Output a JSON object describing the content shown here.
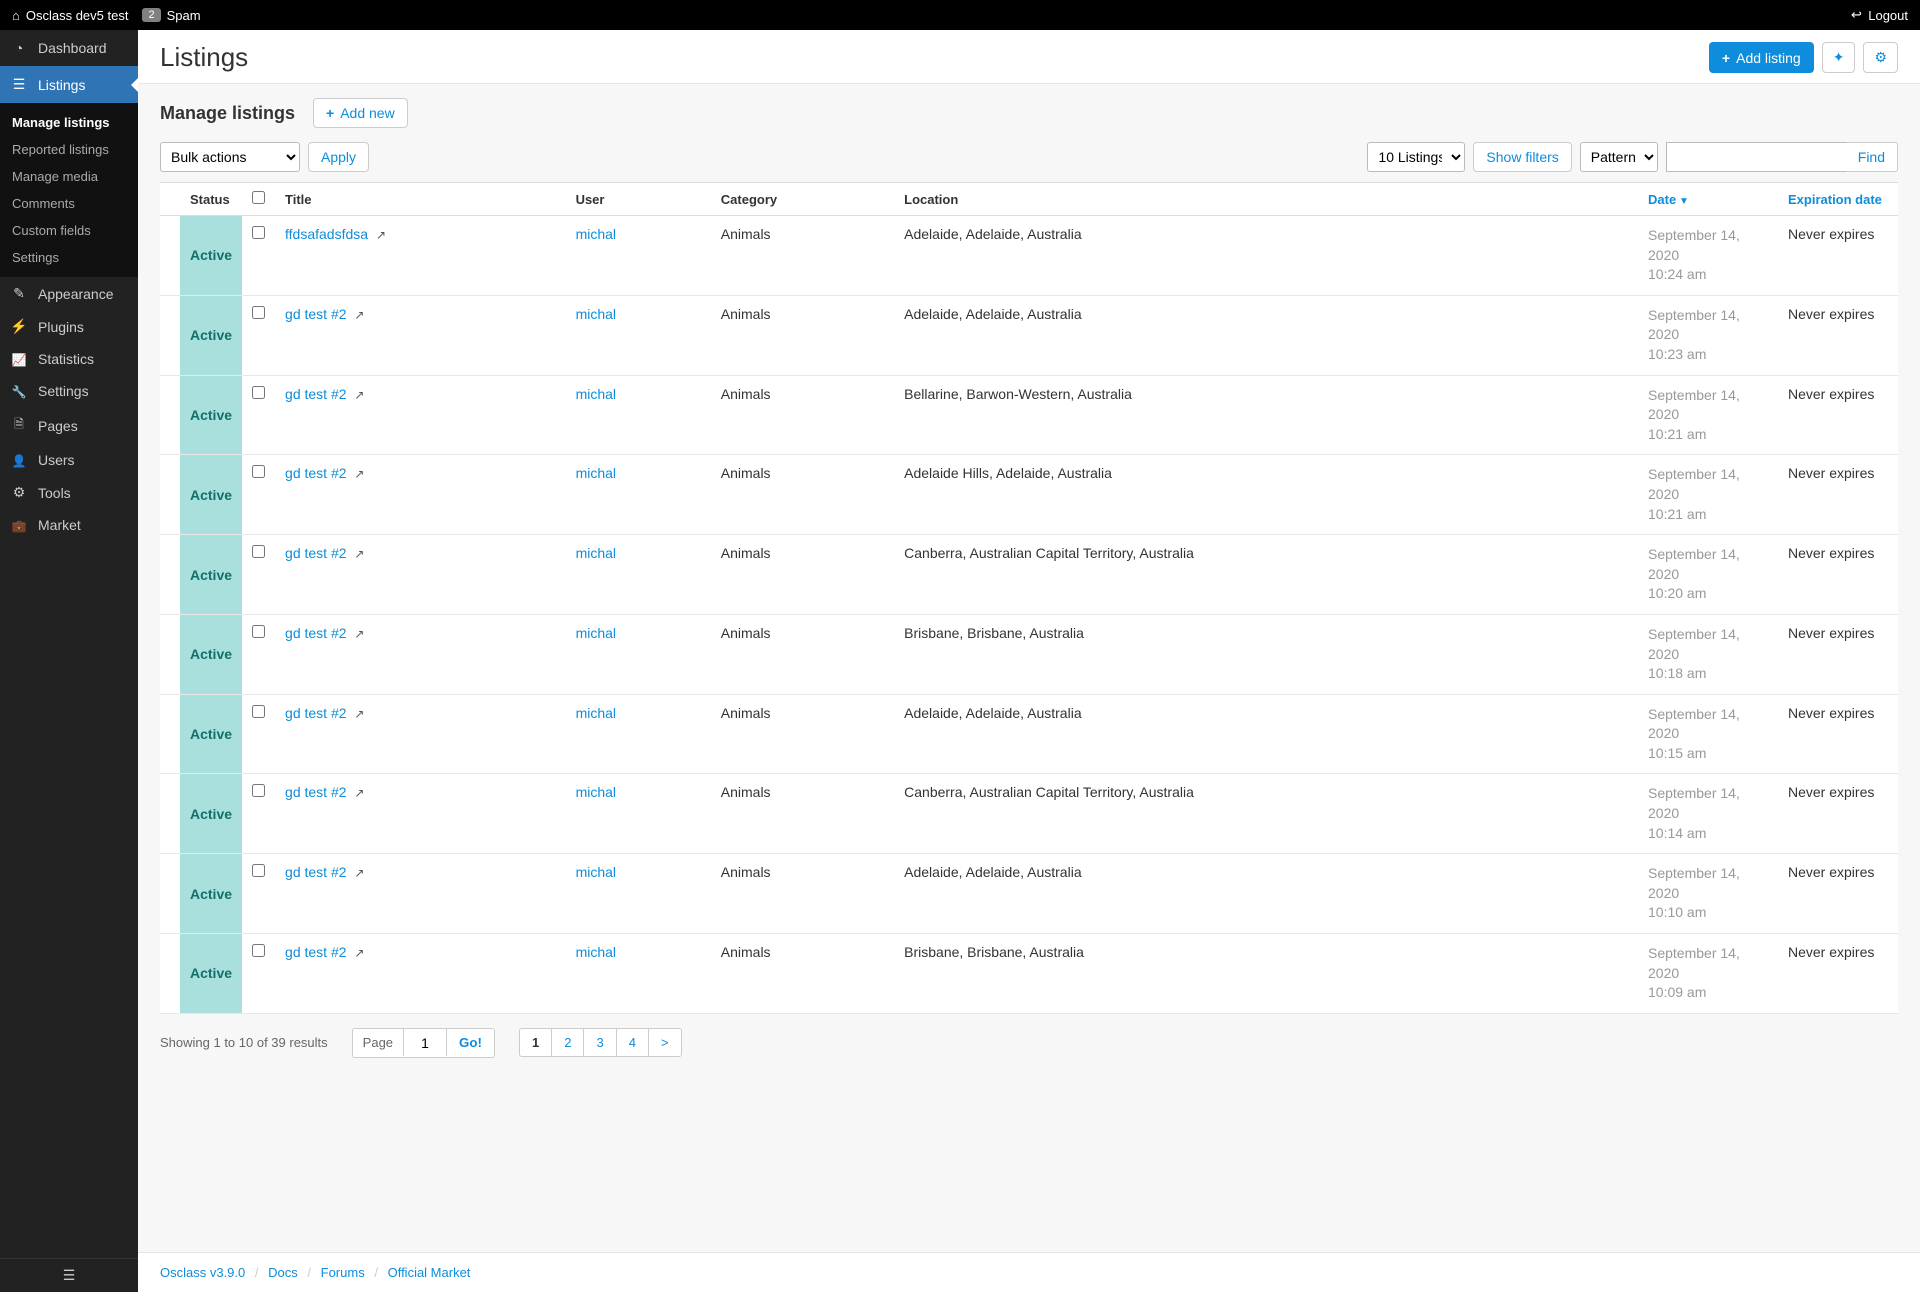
{
  "topbar": {
    "site_name": "Osclass dev5 test",
    "spam_count": "2",
    "spam_label": "Spam",
    "logout": "Logout"
  },
  "sidebar": {
    "items": [
      {
        "label": "Dashboard"
      },
      {
        "label": "Listings"
      },
      {
        "label": "Appearance"
      },
      {
        "label": "Plugins"
      },
      {
        "label": "Statistics"
      },
      {
        "label": "Settings"
      },
      {
        "label": "Pages"
      },
      {
        "label": "Users"
      },
      {
        "label": "Tools"
      },
      {
        "label": "Market"
      }
    ],
    "sub": [
      {
        "label": "Manage listings",
        "active": true
      },
      {
        "label": "Reported listings"
      },
      {
        "label": "Manage media"
      },
      {
        "label": "Comments"
      },
      {
        "label": "Custom fields"
      },
      {
        "label": "Settings"
      }
    ]
  },
  "page": {
    "title": "Listings",
    "add_listing": "Add listing",
    "section_title": "Manage listings",
    "add_new": "Add new"
  },
  "controls": {
    "bulk_actions": "Bulk actions",
    "apply": "Apply",
    "count_select": "10 Listings",
    "show_filters": "Show filters",
    "pattern": "Pattern",
    "find": "Find"
  },
  "columns": {
    "status": "Status",
    "title": "Title",
    "user": "User",
    "category": "Category",
    "location": "Location",
    "date": "Date",
    "expiration": "Expiration date"
  },
  "rows": [
    {
      "status": "Active",
      "title": "ffdsafadsfdsa",
      "user": "michal",
      "category": "Animals",
      "location": "Adelaide, Adelaide, Australia",
      "date": "September 14, 2020",
      "time": "10:24 am",
      "expiration": "Never expires"
    },
    {
      "status": "Active",
      "title": "gd test #2",
      "user": "michal",
      "category": "Animals",
      "location": "Adelaide, Adelaide, Australia",
      "date": "September 14, 2020",
      "time": "10:23 am",
      "expiration": "Never expires"
    },
    {
      "status": "Active",
      "title": "gd test #2",
      "user": "michal",
      "category": "Animals",
      "location": "Bellarine, Barwon-Western, Australia",
      "date": "September 14, 2020",
      "time": "10:21 am",
      "expiration": "Never expires"
    },
    {
      "status": "Active",
      "title": "gd test #2",
      "user": "michal",
      "category": "Animals",
      "location": "Adelaide Hills, Adelaide, Australia",
      "date": "September 14, 2020",
      "time": "10:21 am",
      "expiration": "Never expires"
    },
    {
      "status": "Active",
      "title": "gd test #2",
      "user": "michal",
      "category": "Animals",
      "location": "Canberra, Australian Capital Territory, Australia",
      "date": "September 14, 2020",
      "time": "10:20 am",
      "expiration": "Never expires"
    },
    {
      "status": "Active",
      "title": "gd test #2",
      "user": "michal",
      "category": "Animals",
      "location": "Brisbane, Brisbane, Australia",
      "date": "September 14, 2020",
      "time": "10:18 am",
      "expiration": "Never expires"
    },
    {
      "status": "Active",
      "title": "gd test #2",
      "user": "michal",
      "category": "Animals",
      "location": "Adelaide, Adelaide, Australia",
      "date": "September 14, 2020",
      "time": "10:15 am",
      "expiration": "Never expires"
    },
    {
      "status": "Active",
      "title": "gd test #2",
      "user": "michal",
      "category": "Animals",
      "location": "Canberra, Australian Capital Territory, Australia",
      "date": "September 14, 2020",
      "time": "10:14 am",
      "expiration": "Never expires"
    },
    {
      "status": "Active",
      "title": "gd test #2",
      "user": "michal",
      "category": "Animals",
      "location": "Adelaide, Adelaide, Australia",
      "date": "September 14, 2020",
      "time": "10:10 am",
      "expiration": "Never expires"
    },
    {
      "status": "Active",
      "title": "gd test #2",
      "user": "michal",
      "category": "Animals",
      "location": "Brisbane, Brisbane, Australia",
      "date": "September 14, 2020",
      "time": "10:09 am",
      "expiration": "Never expires"
    }
  ],
  "pagination": {
    "summary": "Showing 1 to 10 of 39 results",
    "page_label": "Page",
    "page_value": "1",
    "go": "Go!",
    "pages": [
      "1",
      "2",
      "3",
      "4",
      ">"
    ],
    "current": "1"
  },
  "footer": {
    "version": "Osclass v3.9.0",
    "links": [
      "Docs",
      "Forums",
      "Official Market"
    ]
  }
}
